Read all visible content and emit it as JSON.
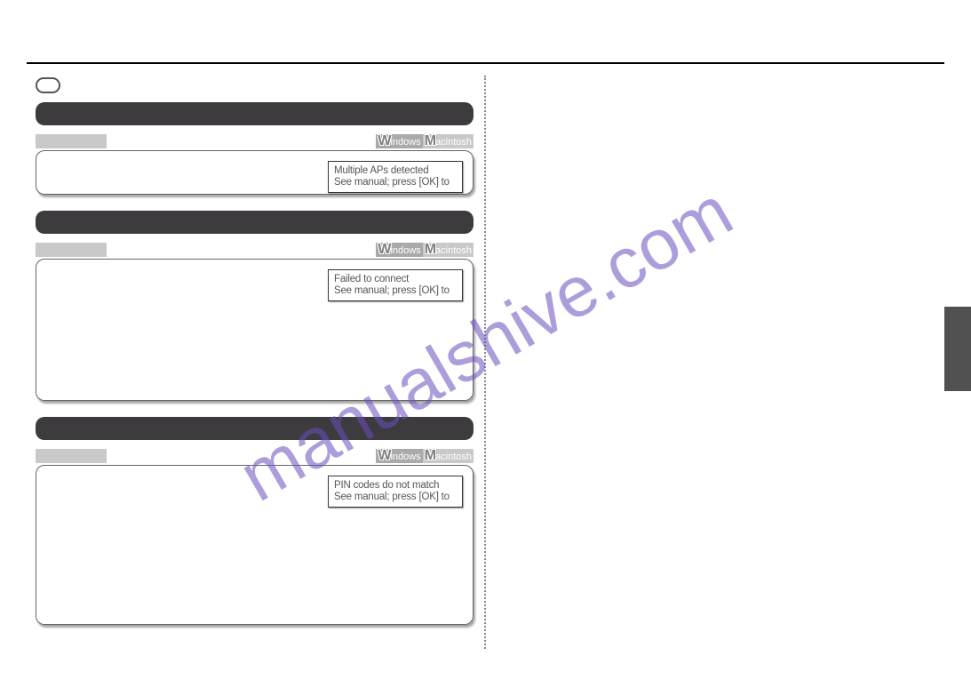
{
  "os_win_big": "W",
  "os_win_rest": "indows",
  "os_mac_big": "M",
  "os_mac_rest": "acintosh",
  "msg1_l1": "Multiple APs detected",
  "msg1_l2": "See manual; press [OK] to",
  "msg2_l1": "Failed to connect",
  "msg2_l2": "See manual; press [OK] to",
  "msg3_l1": "PIN codes do not match",
  "msg3_l2": "See manual; press [OK] to",
  "watermark": "manualshive.com"
}
